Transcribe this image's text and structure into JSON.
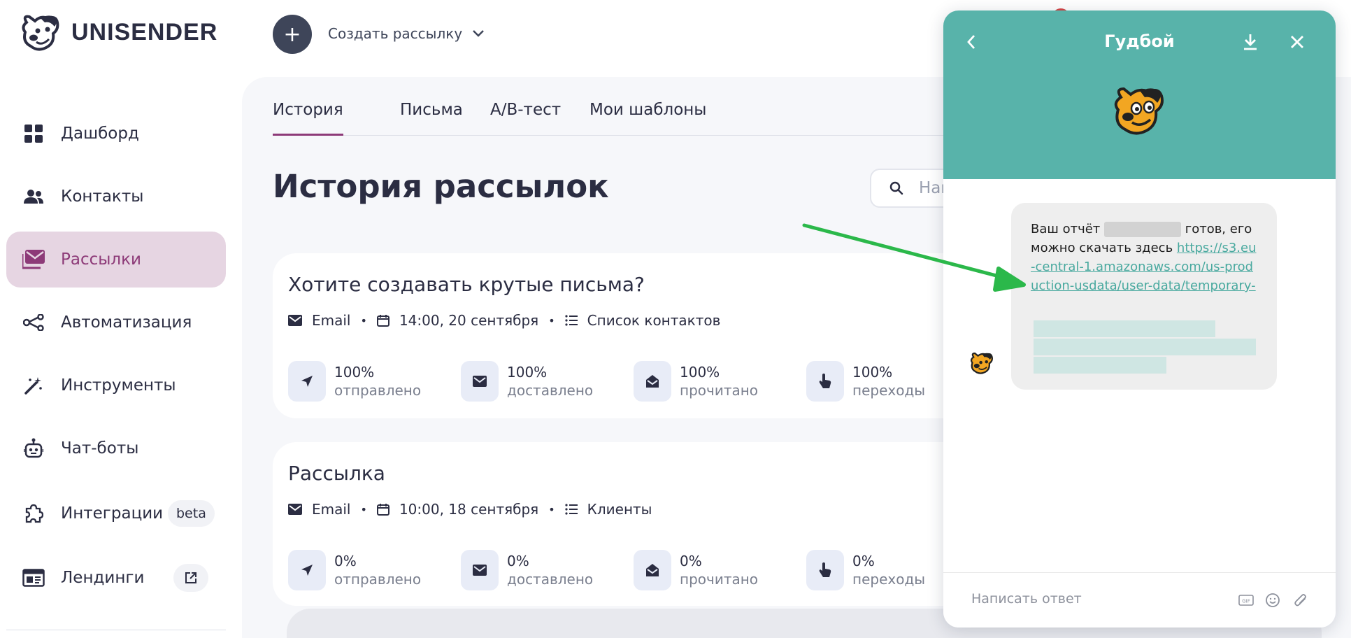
{
  "app": {
    "logo_text": "UNISENDER"
  },
  "colors": {
    "accent": "#8d3a78",
    "chat_header": "#58b3aa",
    "link": "#49a99f",
    "arrow": "#2bb84a",
    "stat_icon_bg": "#e8ecf7"
  },
  "sidebar": {
    "items": [
      {
        "label": "Дашборд",
        "icon": "dashboard-icon",
        "active": false
      },
      {
        "label": "Контакты",
        "icon": "contacts-icon",
        "active": false
      },
      {
        "label": "Рассылки",
        "icon": "mail-icon",
        "active": true
      },
      {
        "label": "Автоматизация",
        "icon": "automation-icon",
        "active": false
      },
      {
        "label": "Инструменты",
        "icon": "magic-wand-icon",
        "active": false
      },
      {
        "label": "Чат-боты",
        "icon": "robot-icon",
        "active": false
      },
      {
        "label": "Интеграции",
        "icon": "puzzle-icon",
        "active": false,
        "badge": "beta"
      },
      {
        "label": "Лендинги",
        "icon": "landing-icon",
        "active": false,
        "external_icon": "external-link-icon"
      }
    ]
  },
  "topbar": {
    "create_label": "Создать рассылку"
  },
  "main": {
    "tabs": [
      {
        "label": "История",
        "active": true
      },
      {
        "label": "Письма",
        "active": false
      },
      {
        "label": "A/B-тест",
        "active": false
      },
      {
        "label": "Мои шаблоны",
        "active": false
      }
    ],
    "title": "История рассылок",
    "search": {
      "placeholder": "Найти"
    },
    "campaigns": [
      {
        "title": "Хотите создавать крутые письма?",
        "channel": "Email",
        "datetime": "14:00, 20 сентября",
        "list": "Список контактов",
        "stats": [
          {
            "value": "100%",
            "label": "отправлено",
            "icon": "send-icon"
          },
          {
            "value": "100%",
            "label": "доставлено",
            "icon": "envelope-icon"
          },
          {
            "value": "100%",
            "label": "прочитано",
            "icon": "open-envelope-icon"
          },
          {
            "value": "100%",
            "label": "переходы",
            "icon": "pointer-hand-icon"
          }
        ]
      },
      {
        "title": "Рассылка",
        "channel": "Email",
        "datetime": "10:00, 18 сентября",
        "list": "Клиенты",
        "stats": [
          {
            "value": "0%",
            "label": "отправлено",
            "icon": "send-icon"
          },
          {
            "value": "0%",
            "label": "доставлено",
            "icon": "envelope-icon"
          },
          {
            "value": "0%",
            "label": "прочитано",
            "icon": "open-envelope-icon"
          },
          {
            "value": "0%",
            "label": "переходы",
            "icon": "pointer-hand-icon"
          }
        ]
      }
    ]
  },
  "chat": {
    "title": "Гудбой",
    "message": {
      "part1": "Ваш отчёт",
      "part2": "готов, его можно скачать здесь",
      "link": "https://s3.eu-central-1.amazonaws.com/us-production-usdata/user-data/temporary-"
    },
    "reply_placeholder": "Написать ответ",
    "footer_icons": [
      "gif-icon",
      "emoji-icon",
      "paperclip-icon"
    ]
  }
}
